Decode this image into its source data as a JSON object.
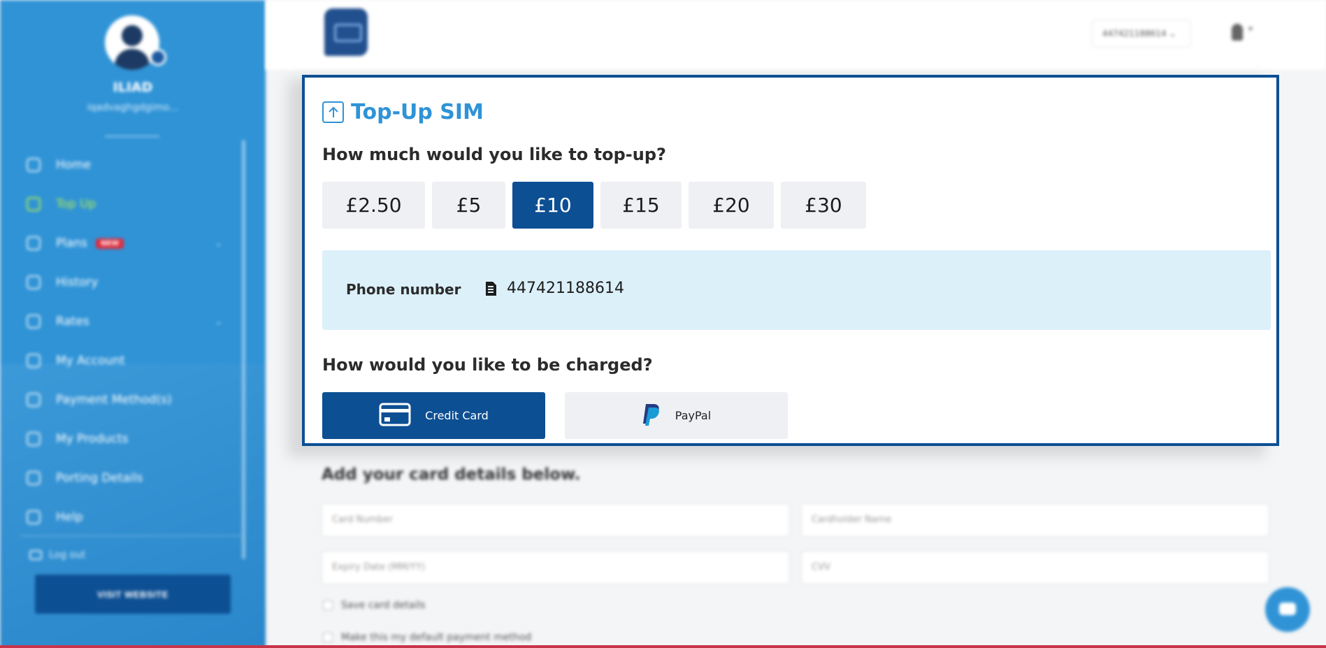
{
  "sidebar": {
    "user_name": "ILIAD",
    "user_email": "iqadvaghgdgimo...",
    "items": [
      {
        "label": "Home",
        "icon": "clock-icon"
      },
      {
        "label": "Top Up",
        "icon": "topup-icon",
        "active": true
      },
      {
        "label": "Plans",
        "icon": "bag-icon",
        "badge": "NEW",
        "has_submenu": true
      },
      {
        "label": "History",
        "icon": "history-icon"
      },
      {
        "label": "Rates",
        "icon": "pound-icon",
        "has_submenu": true
      },
      {
        "label": "My Account",
        "icon": "user-icon"
      },
      {
        "label": "Payment Method(s)",
        "icon": "card-icon"
      },
      {
        "label": "My Products",
        "icon": "sim-icon"
      },
      {
        "label": "Porting Details",
        "icon": "link-icon"
      },
      {
        "label": "Help",
        "icon": "help-icon"
      }
    ],
    "logout_label": "Log out",
    "visit_button": "VISIT WEBSITE"
  },
  "header": {
    "phone_select": "447421188614",
    "user_menu_icon": "user-icon"
  },
  "topup": {
    "title": "Top-Up SIM",
    "amount_question": "How much would you like to top-up?",
    "amounts": [
      "£2.50",
      "£5",
      "£10",
      "£15",
      "£20",
      "£30"
    ],
    "selected_amount": "£10",
    "phone_label": "Phone number",
    "phone_number": "447421188614",
    "charge_question": "How would you like to be charged?",
    "payment_methods": [
      {
        "label": "Credit Card",
        "icon": "credit-card-icon",
        "selected": true
      },
      {
        "label": "PayPal",
        "icon": "paypal-icon",
        "selected": false
      }
    ]
  },
  "card_form": {
    "heading": "Add your card details below.",
    "card_number_placeholder": "Card Number",
    "cardholder_placeholder": "Cardholder Name",
    "expiry_placeholder": "Expiry Date (MM/YY)",
    "cvv_placeholder": "CVV",
    "save_card_label": "Save card details",
    "default_label": "Make this my default payment method"
  },
  "colors": {
    "sidebar_bg": "#2f93d6",
    "primary": "#0d4f93",
    "accent": "#2f93d6",
    "active_nav": "#b8ef4a",
    "phone_box_bg": "#dcf0fa"
  }
}
